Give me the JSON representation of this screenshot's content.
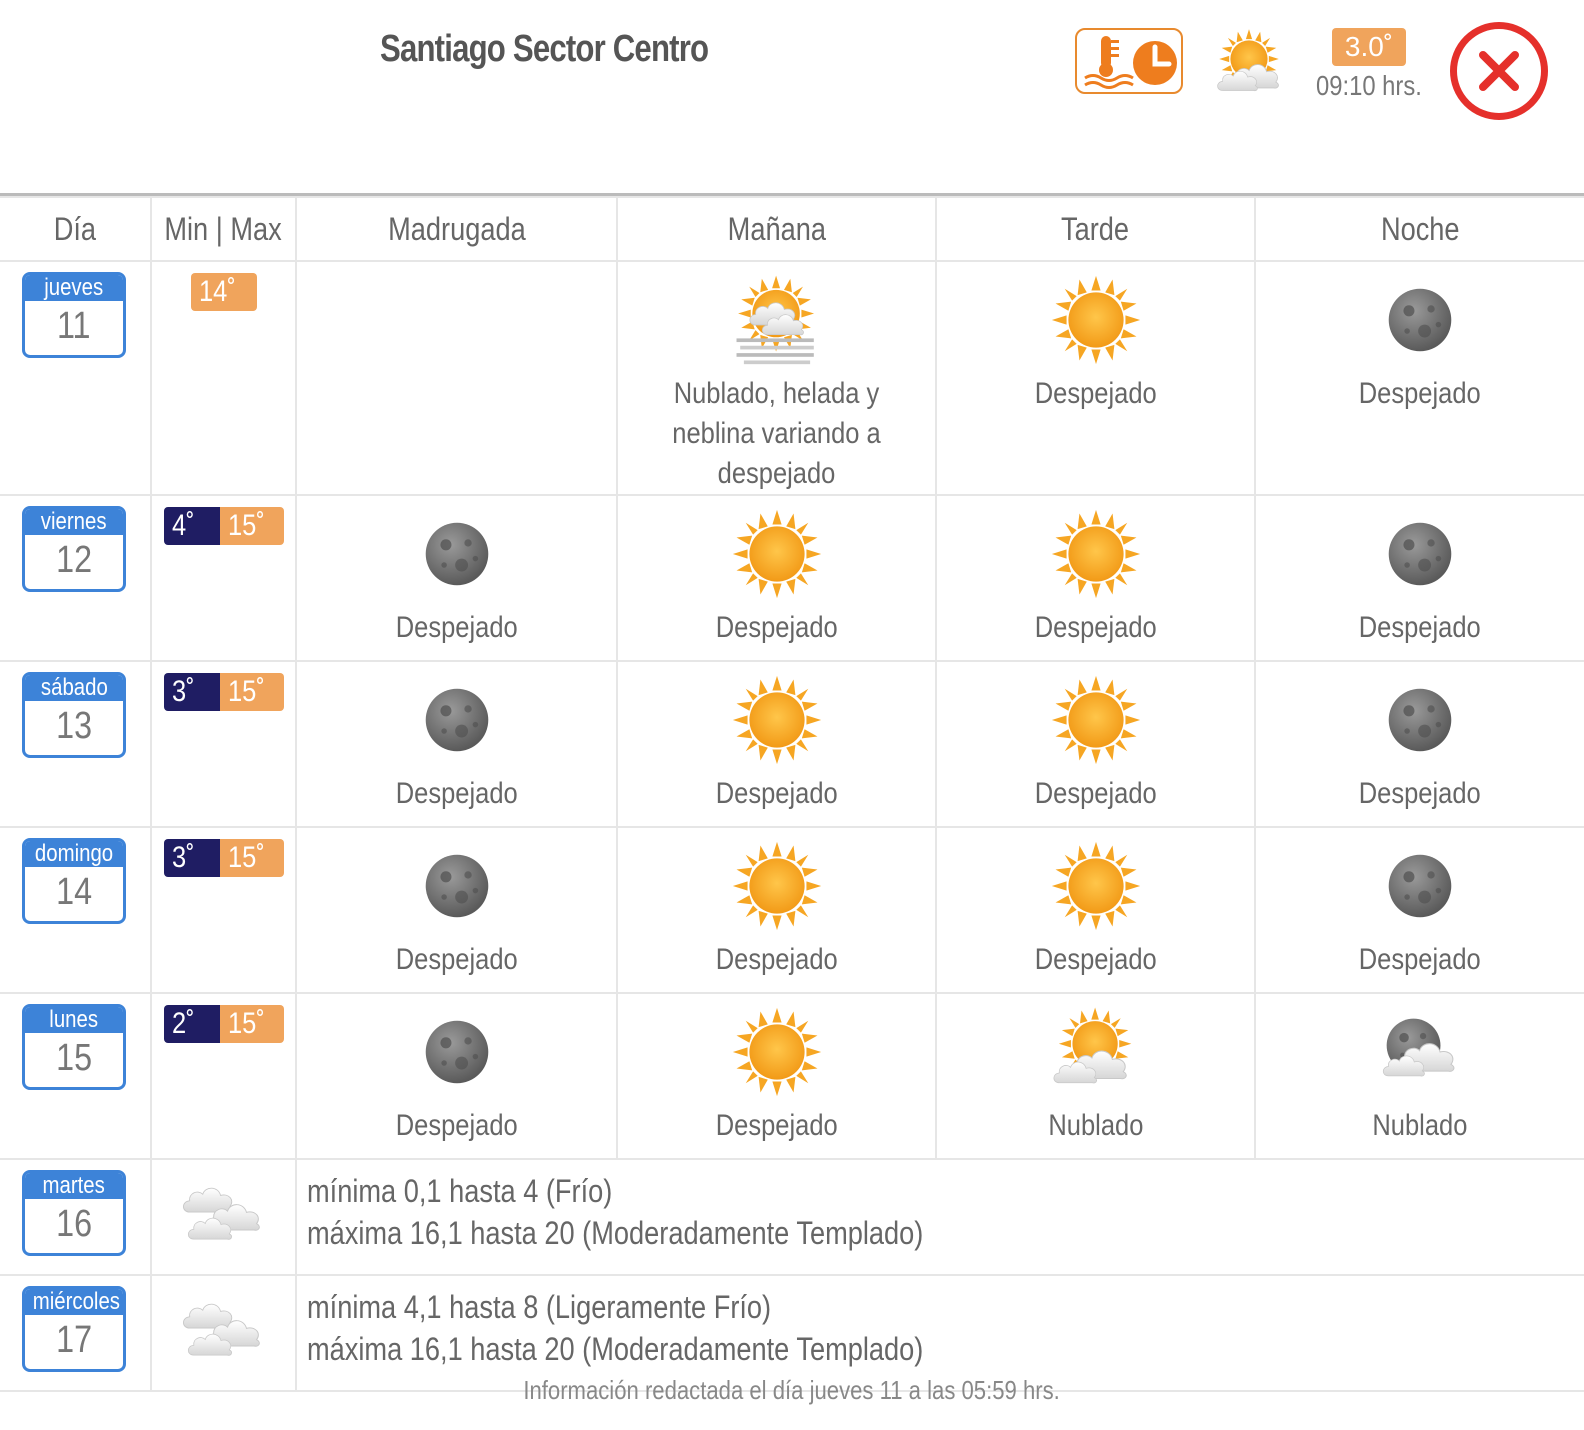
{
  "header": {
    "title": "Santiago Sector Centro",
    "current_temp": "3.0˚",
    "current_time": "09:10 hrs.",
    "current_icon": "partly-cloudy-icon"
  },
  "table": {
    "headers": [
      "Día",
      "Min | Max",
      "Madrugada",
      "Mañana",
      "Tarde",
      "Noche"
    ],
    "rows": [
      {
        "day": "jueves",
        "date": "11",
        "min": "",
        "max": "14˚",
        "madrugada": {
          "icon": "",
          "desc": ""
        },
        "manana": {
          "icon": "fog-cloud-sun-icon",
          "desc": "Nublado, helada y neblina variando a despejado"
        },
        "tarde": {
          "icon": "sun-icon",
          "desc": "Despejado"
        },
        "noche": {
          "icon": "moon-icon",
          "desc": "Despejado"
        }
      },
      {
        "day": "viernes",
        "date": "12",
        "min": "4˚",
        "max": "15˚",
        "madrugada": {
          "icon": "moon-icon",
          "desc": "Despejado"
        },
        "manana": {
          "icon": "sun-icon",
          "desc": "Despejado"
        },
        "tarde": {
          "icon": "sun-icon",
          "desc": "Despejado"
        },
        "noche": {
          "icon": "moon-icon",
          "desc": "Despejado"
        }
      },
      {
        "day": "sábado",
        "date": "13",
        "min": "3˚",
        "max": "15˚",
        "madrugada": {
          "icon": "moon-icon",
          "desc": "Despejado"
        },
        "manana": {
          "icon": "sun-icon",
          "desc": "Despejado"
        },
        "tarde": {
          "icon": "sun-icon",
          "desc": "Despejado"
        },
        "noche": {
          "icon": "moon-icon",
          "desc": "Despejado"
        }
      },
      {
        "day": "domingo",
        "date": "14",
        "min": "3˚",
        "max": "15˚",
        "madrugada": {
          "icon": "moon-icon",
          "desc": "Despejado"
        },
        "manana": {
          "icon": "sun-icon",
          "desc": "Despejado"
        },
        "tarde": {
          "icon": "sun-icon",
          "desc": "Despejado"
        },
        "noche": {
          "icon": "moon-icon",
          "desc": "Despejado"
        }
      },
      {
        "day": "lunes",
        "date": "15",
        "min": "2˚",
        "max": "15˚",
        "madrugada": {
          "icon": "moon-icon",
          "desc": "Despejado"
        },
        "manana": {
          "icon": "sun-icon",
          "desc": "Despejado"
        },
        "tarde": {
          "icon": "cloudy-sun-icon",
          "desc": "Nublado"
        },
        "noche": {
          "icon": "cloudy-moon-icon",
          "desc": "Nublado"
        }
      }
    ],
    "extended": [
      {
        "day": "martes",
        "date": "16",
        "icon": "clouds-icon",
        "line1": "mínima 0,1 hasta 4 (Frío)",
        "line2": "máxima 16,1 hasta 20 (Moderadamente Templado)"
      },
      {
        "day": "miércoles",
        "date": "17",
        "icon": "clouds-icon",
        "line1": "mínima 4,1 hasta 8 (Ligeramente Frío)",
        "line2": "máxima 16,1 hasta 20 (Moderadamente Templado)"
      }
    ]
  },
  "footer": "Información redactada el día jueves 11 a las 05:59 hrs."
}
